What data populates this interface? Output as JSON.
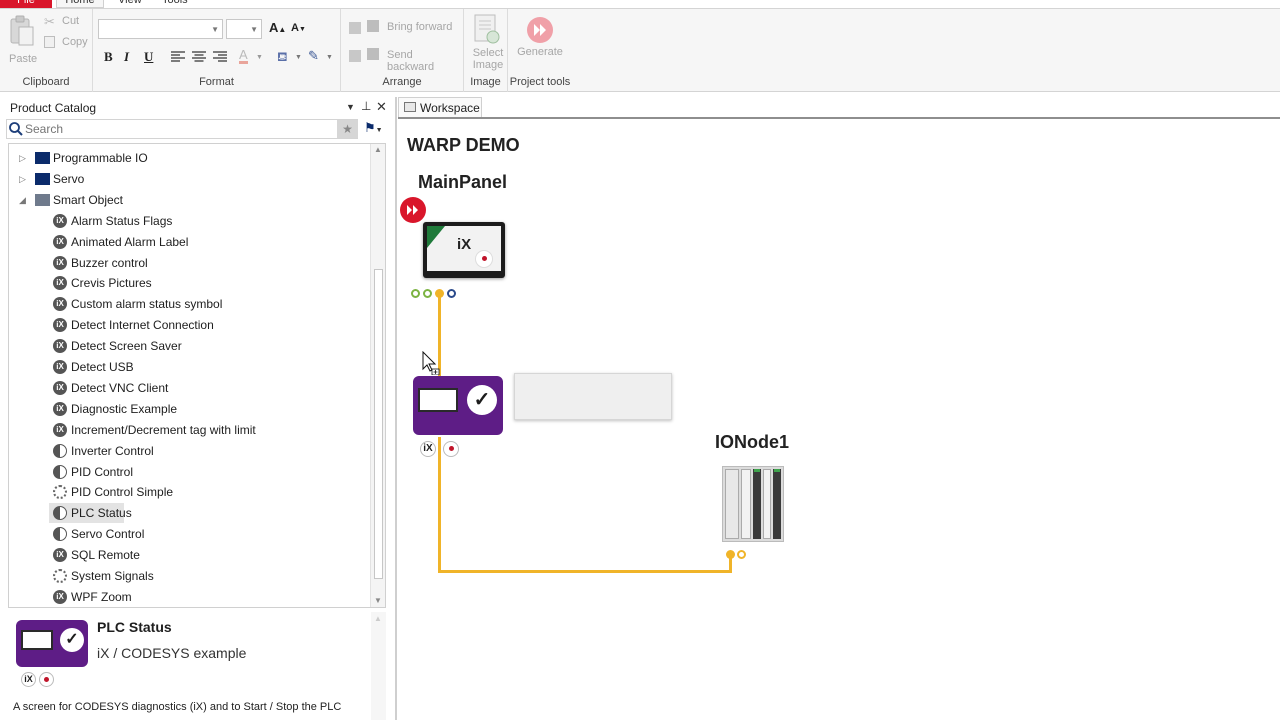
{
  "ribbon": {
    "tabs": [
      {
        "label": "File"
      },
      {
        "label": "Home"
      },
      {
        "label": "View"
      },
      {
        "label": "Tools"
      }
    ],
    "clipboard": {
      "label": "Clipboard",
      "paste": "Paste",
      "cut": "Cut",
      "copy": "Copy"
    },
    "format": {
      "label": "Format",
      "bold": "B",
      "italic": "I",
      "underline": "U",
      "grow": "A",
      "shrink": "A"
    },
    "arrange": {
      "label": "Arrange",
      "bring_forward": "Bring forward",
      "send_backward": "Send backward"
    },
    "image": {
      "label": "Image",
      "select_image": "Select Image"
    },
    "project_tools": {
      "label": "Project tools",
      "generate": "Generate"
    }
  },
  "catalog": {
    "title": "Product Catalog",
    "search_placeholder": "Search",
    "items": [
      {
        "label": "Programmable IO",
        "type": "folder"
      },
      {
        "label": "Servo",
        "type": "folder"
      },
      {
        "label": "Smart Object",
        "type": "folder-open"
      },
      {
        "label": "Alarm Status Flags",
        "type": "ix"
      },
      {
        "label": "Animated Alarm Label",
        "type": "ix"
      },
      {
        "label": "Buzzer control",
        "type": "ix"
      },
      {
        "label": "Crevis Pictures",
        "type": "ix"
      },
      {
        "label": "Custom alarm status symbol",
        "type": "ix"
      },
      {
        "label": "Detect Internet Connection",
        "type": "ix"
      },
      {
        "label": "Detect Screen Saver",
        "type": "ix"
      },
      {
        "label": "Detect USB",
        "type": "ix"
      },
      {
        "label": "Detect VNC Client",
        "type": "ix"
      },
      {
        "label": "Diagnostic Example",
        "type": "ix"
      },
      {
        "label": "Increment/Decrement tag with limit",
        "type": "ix"
      },
      {
        "label": "Inverter Control",
        "type": "split"
      },
      {
        "label": "PID Control",
        "type": "split"
      },
      {
        "label": "PID Control Simple",
        "type": "gear"
      },
      {
        "label": "PLC Status",
        "type": "split"
      },
      {
        "label": "Servo Control",
        "type": "split"
      },
      {
        "label": "SQL Remote",
        "type": "ix"
      },
      {
        "label": "System Signals",
        "type": "gear"
      },
      {
        "label": "WPF Zoom",
        "type": "ix"
      }
    ],
    "selected": "PLC Status"
  },
  "preview": {
    "title": "PLC Status",
    "subtitle": "iX / CODESYS example",
    "description": "A screen for CODESYS diagnostics (iX) and to Start / Stop the PLC",
    "badge_ix": "iX"
  },
  "workspace": {
    "tab": "Workspace",
    "project_title": "WARP DEMO",
    "main_panel": "MainPanel",
    "io_node": "IONode1",
    "panel_screen_text": "iX",
    "badge_ix": "iX"
  },
  "colors": {
    "accent_red": "#d9162b",
    "connector": "#f0b429",
    "tile_purple": "#5e1d86"
  }
}
